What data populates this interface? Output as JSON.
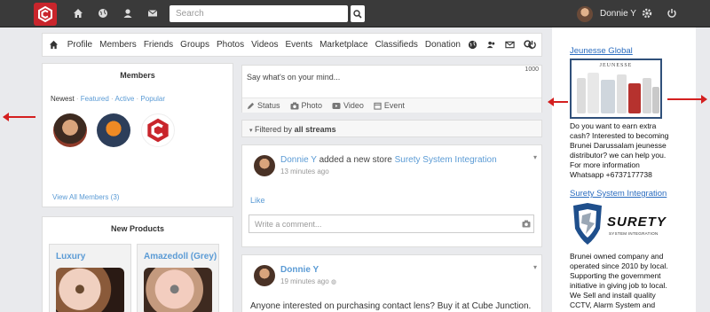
{
  "topbar": {
    "search_placeholder": "Search",
    "user_name": "Donnie Y",
    "icons": [
      "home-icon",
      "globe-icon",
      "user-icon",
      "mail-icon",
      "search-icon",
      "gear-icon",
      "power-icon"
    ]
  },
  "nav": {
    "items": [
      "Profile",
      "Members",
      "Friends",
      "Groups",
      "Photos",
      "Videos",
      "Events",
      "Marketplace",
      "Classifieds",
      "Donation"
    ]
  },
  "members": {
    "title": "Members",
    "tab_selected": "Newest",
    "tabs": [
      "Featured",
      "Active",
      "Popular"
    ],
    "view_all": "View All Members (3)"
  },
  "products": {
    "title": "New Products",
    "items": [
      {
        "name": "Luxury"
      },
      {
        "name": "Amazedoll (Grey)"
      }
    ]
  },
  "composer": {
    "placeholder": "Say what's on your mind...",
    "counter": "1000",
    "tabs": [
      "Status",
      "Photo",
      "Video",
      "Event"
    ]
  },
  "filter": {
    "label": "Filtered by",
    "value": "all streams"
  },
  "posts": [
    {
      "author": "Donnie Y",
      "action": "added a new store",
      "target": "Surety System Integration",
      "time": "13 minutes ago",
      "like": "Like",
      "comment_placeholder": "Write a comment..."
    },
    {
      "author": "Donnie Y",
      "time": "19 minutes ago",
      "body": "Anyone interested on purchasing contact lens? Buy it at Cube Junction. From"
    }
  ],
  "ads": [
    {
      "title": "Jeunesse Global",
      "image_caption": "JEUNESSE",
      "text": "Do you want to earn extra cash? Interested to becoming Brunei Darussalam jeunesse distributor? we can help you. For more information Whatsapp +6737177738"
    },
    {
      "title": "Surety System Integration",
      "logo_text": "SURETY",
      "logo_sub": "SYSTEM INTEGRATION",
      "text": "Brunei owned company and operated since 2010 by local. Supporting the government initiative in giving job to local. We Sell and install quality CCTV, Alarm System and"
    }
  ],
  "colors": {
    "topbar": "#3a3a3a",
    "brand_red": "#c9252c",
    "link_blue": "#5b9bd5",
    "ad_link": "#2a6cbf"
  }
}
